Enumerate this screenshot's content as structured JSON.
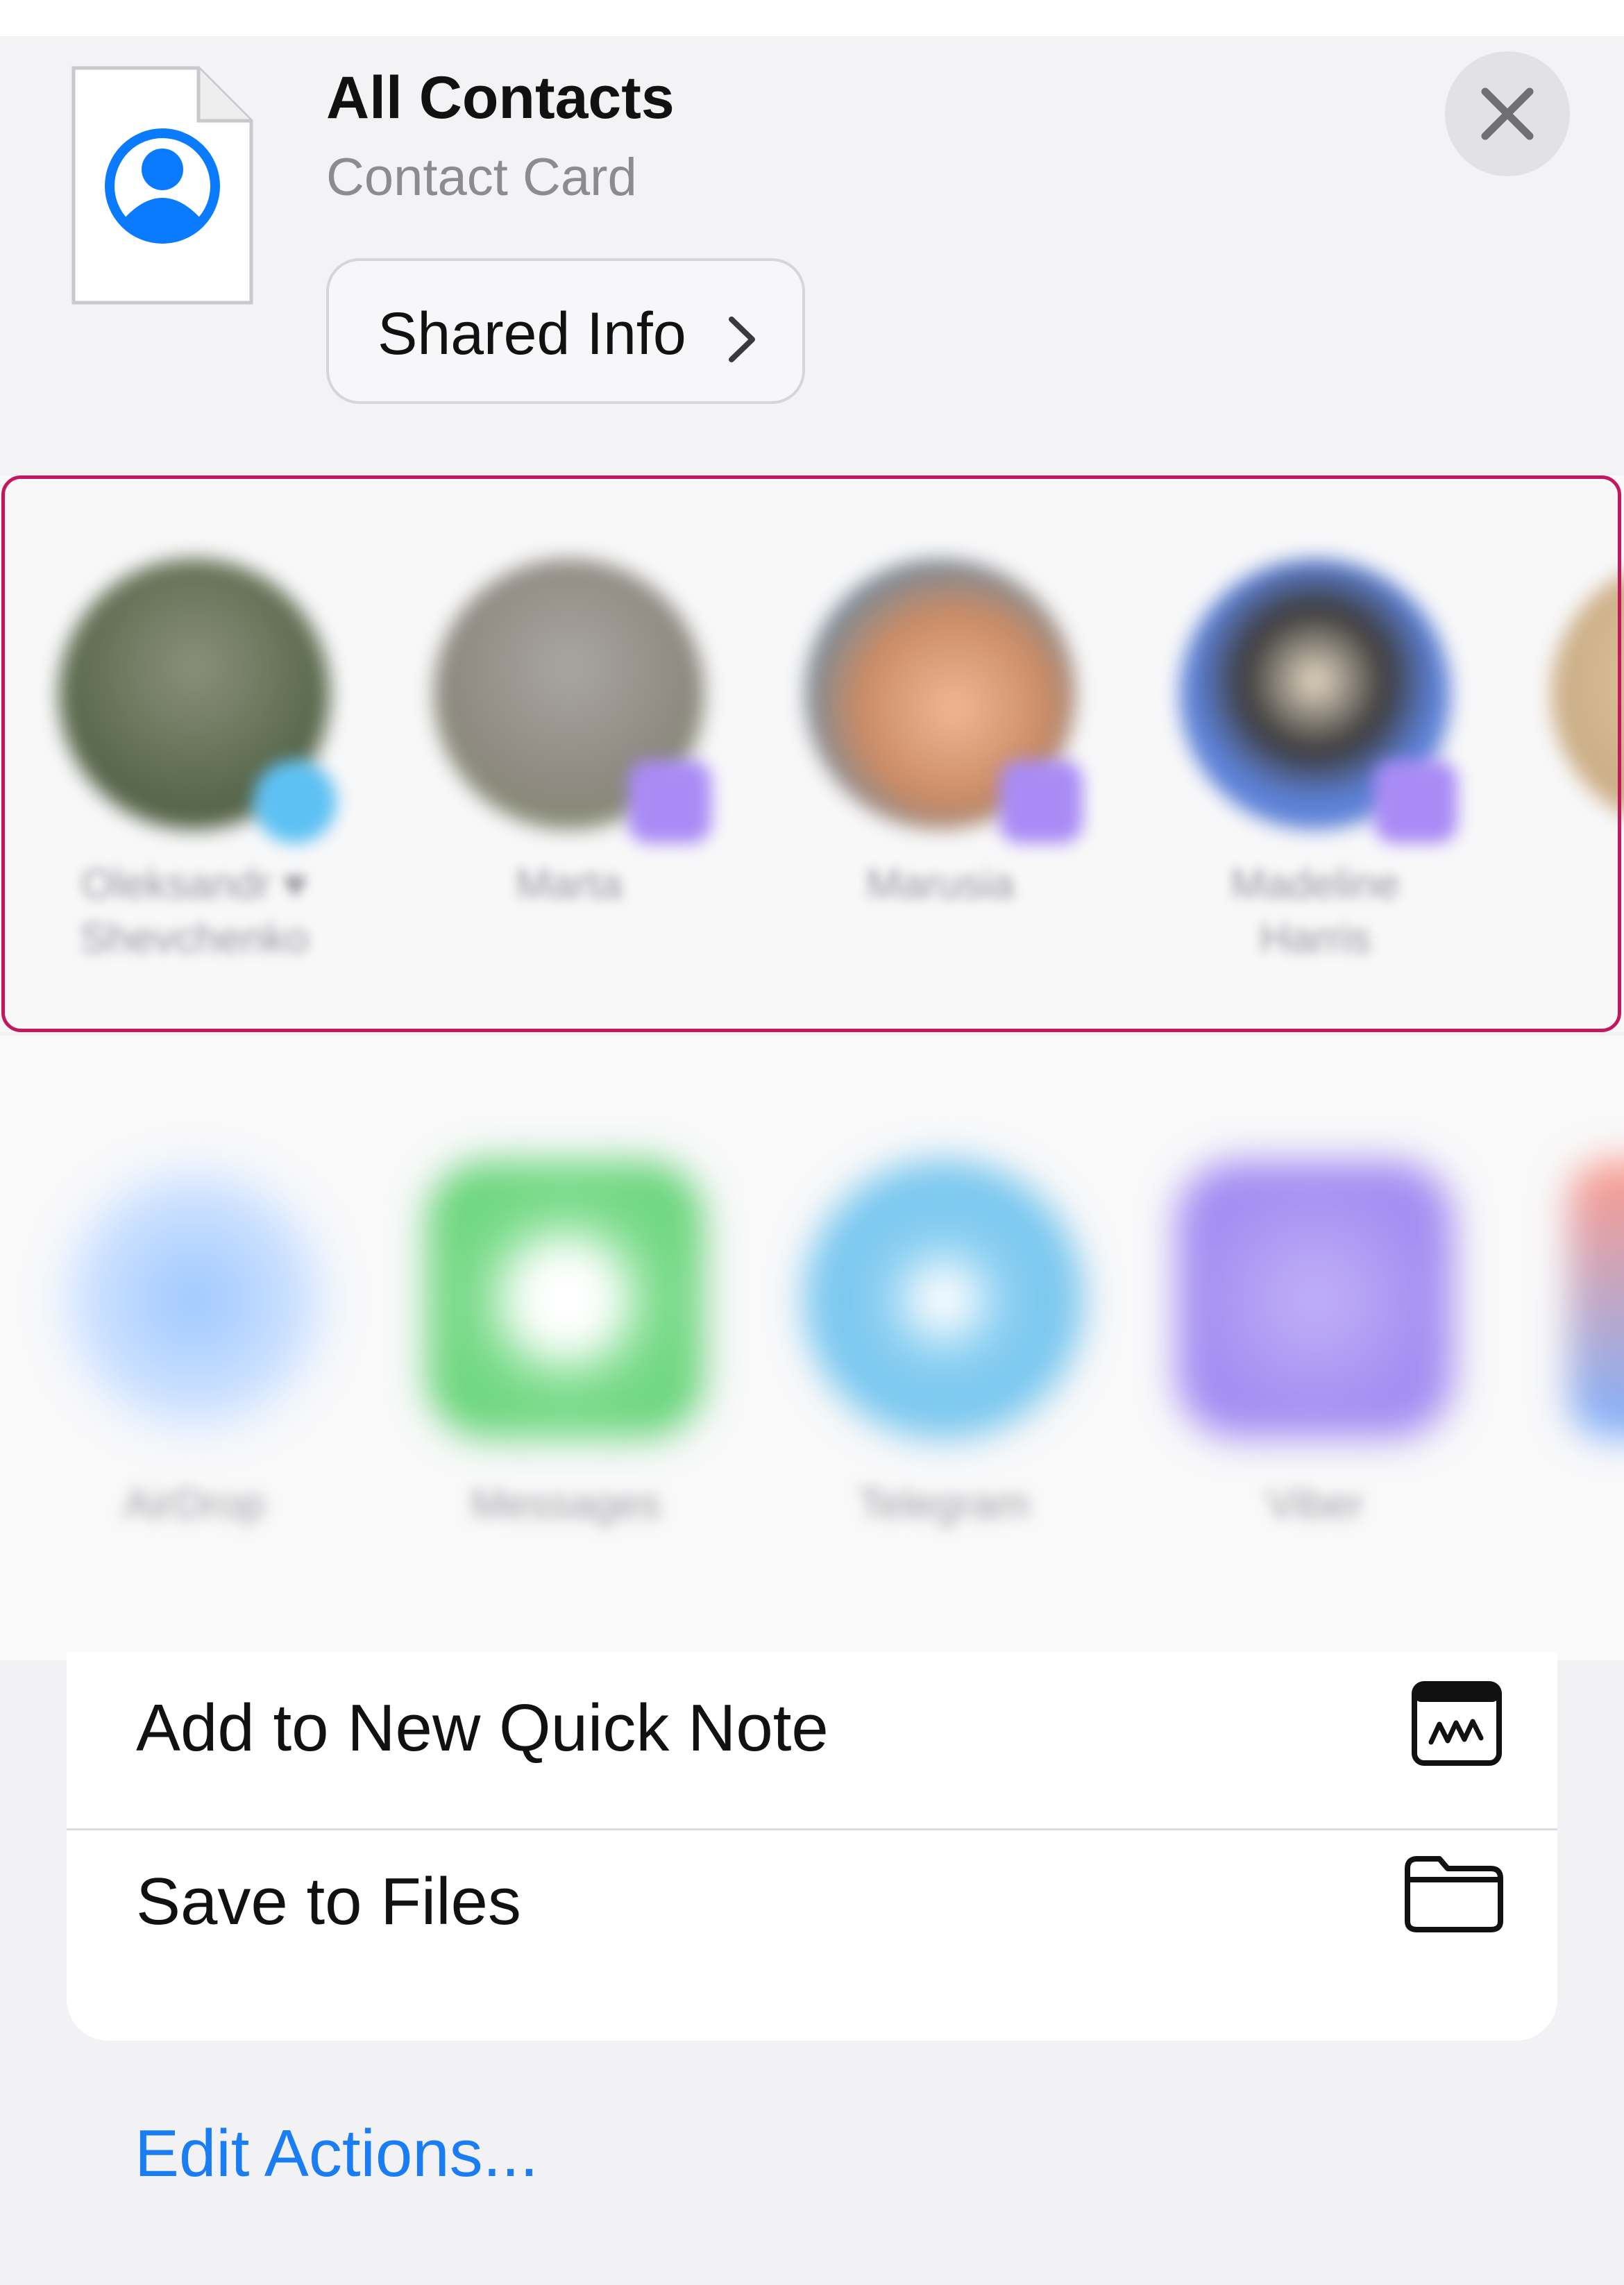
{
  "header": {
    "title": "All Contacts",
    "subtitle": "Contact Card",
    "shared_info_label": "Shared Info",
    "icon": "contact-file-icon",
    "close_icon": "close-icon"
  },
  "people": [
    {
      "name": "Oleksandr ♥ Shevchenko",
      "badge_color": "#5ec1f3"
    },
    {
      "name": "Marta",
      "badge_color": "#a98bf5"
    },
    {
      "name": "Mаrusia",
      "badge_color": "#a98bf5"
    },
    {
      "name": "Madeline Harris",
      "badge_color": "#a98bf5"
    }
  ],
  "apps": [
    {
      "name": "AirDrop",
      "color": "#2f8cff"
    },
    {
      "name": "Messages",
      "color": "#34c759"
    },
    {
      "name": "Telegram",
      "color": "#2aa7e4"
    },
    {
      "name": "Viber",
      "color": "#7d5fe3"
    }
  ],
  "actions": [
    {
      "label": "Add to New Quick Note",
      "icon": "quick-note-icon"
    },
    {
      "label": "Save to Files",
      "icon": "folder-icon"
    }
  ],
  "edit_actions_label": "Edit Actions...",
  "colors": {
    "accent": "#1a7df4",
    "highlight": "#c4175f",
    "contact_icon": "#0a7aff"
  }
}
